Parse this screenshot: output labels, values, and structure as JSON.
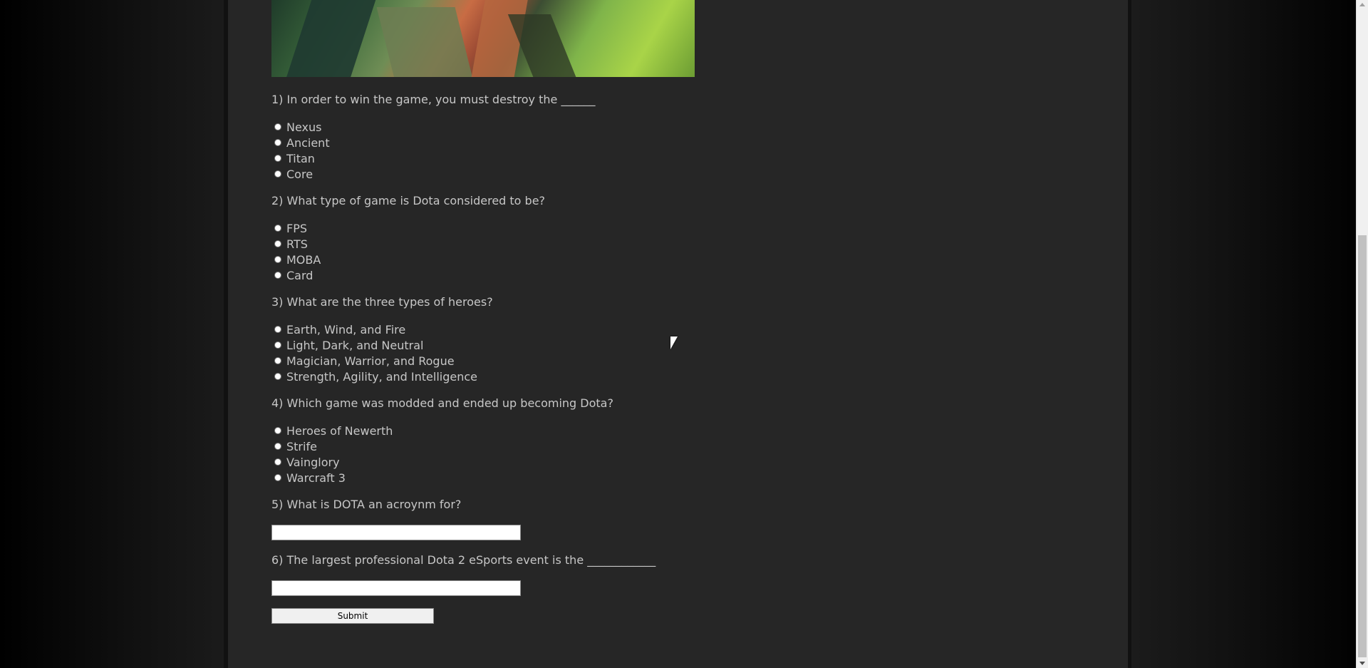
{
  "quiz": {
    "questions": [
      {
        "prompt": "1) In order to win the game, you must destroy the ______",
        "options": [
          "Nexus",
          "Ancient",
          "Titan",
          "Core"
        ]
      },
      {
        "prompt": "2) What type of game is Dota considered to be?",
        "options": [
          "FPS",
          "RTS",
          "MOBA",
          "Card"
        ]
      },
      {
        "prompt": "3) What are the three types of heroes?",
        "options": [
          "Earth, Wind, and Fire",
          "Light, Dark, and Neutral",
          "Magician, Warrior, and Rogue",
          "Strength, Agility, and Intelligence"
        ]
      },
      {
        "prompt": "4) Which game was modded and ended up becoming Dota?",
        "options": [
          "Heroes of Newerth",
          "Strife",
          "Vainglory",
          "Warcraft 3"
        ]
      },
      {
        "prompt": "5) What is DOTA an acroynm for?",
        "input_value": ""
      },
      {
        "prompt": "6) The largest professional Dota 2 eSports event is the ____________",
        "input_value": ""
      }
    ],
    "submit_label": "Submit"
  },
  "icons": {
    "cursor": "arrow-cursor-icon",
    "scroll_up": "scroll-up-arrow-icon",
    "scroll_down": "scroll-down-arrow-icon"
  }
}
